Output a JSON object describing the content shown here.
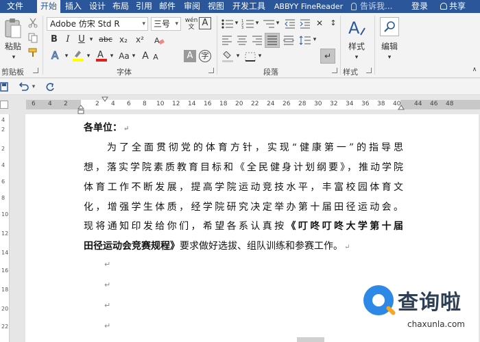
{
  "tabs": [
    "文件",
    "开始",
    "插入",
    "设计",
    "布局",
    "引用",
    "邮件",
    "审阅",
    "视图",
    "开发工具",
    "ABBYY FineReader"
  ],
  "active_tab": "开始",
  "tell_me": "告诉我...",
  "login": "登录",
  "share": "共享",
  "clipboard": {
    "paste": "粘贴",
    "label": "剪贴板"
  },
  "font": {
    "name": "Adobe 仿宋 Std R",
    "size": "三号",
    "label": "字体",
    "bold": "B",
    "italic": "I",
    "underline": "U",
    "strike": "abc",
    "subscript": "x₂",
    "superscript": "x²",
    "grow": "A",
    "shrink": "A",
    "case": "Aa",
    "wen": "wén"
  },
  "paragraph": {
    "label": "段落"
  },
  "styles": {
    "button": "样式",
    "label": "样式"
  },
  "editing": {
    "button": "编辑"
  },
  "ruler": {
    "horizontal": [
      "6",
      "4",
      "2",
      "2",
      "4",
      "6",
      "8",
      "10",
      "12",
      "14",
      "16",
      "18",
      "20",
      "22",
      "24",
      "26",
      "28",
      "30",
      "32",
      "34",
      "36",
      "38",
      "40",
      "44",
      "46",
      "48"
    ],
    "vertical": [
      "4",
      "2",
      "2",
      "4",
      "6",
      "8",
      "10",
      "12",
      "14",
      "16",
      "18",
      "20",
      "22"
    ]
  },
  "document": {
    "heading": "各单位：",
    "lines": [
      "为了全面贯彻党的体育方针，实现“健康第一”的指导思",
      "想，落实学院素质教育目标和《全民健身计划纲要》，推动学院",
      "体育工作不断发展，提高学院运动竞技水平，丰富校园体育文",
      "化，增强学生体质，经学院研究决定举办第十届田径运动会。",
      "现将通知印发给你们，希望各系认真按"
    ],
    "bold_title_1": "《叮咚叮咚大学第十届",
    "bold_title_2": "田径运动会竞赛规程》",
    "last_tail": "要求做好选拔、组队训练和参赛工作。",
    "para_mark": "↵"
  },
  "watermark": {
    "brand": "查询啦",
    "url": "chaxunla.com"
  },
  "colors": {
    "accent": "#2b579a",
    "highlight": "#ffff00",
    "font_color": "#e02020"
  }
}
